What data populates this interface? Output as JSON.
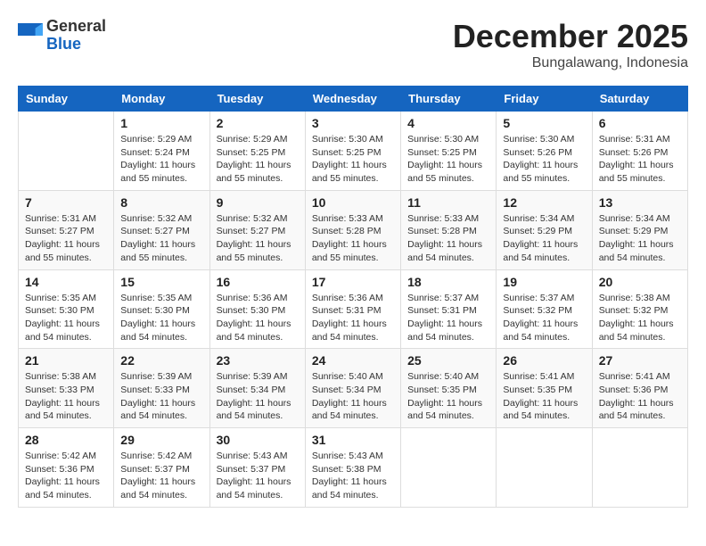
{
  "logo": {
    "general": "General",
    "blue": "Blue"
  },
  "header": {
    "month": "December 2025",
    "location": "Bungalawang, Indonesia"
  },
  "weekdays": [
    "Sunday",
    "Monday",
    "Tuesday",
    "Wednesday",
    "Thursday",
    "Friday",
    "Saturday"
  ],
  "weeks": [
    [
      {
        "day": "",
        "info": ""
      },
      {
        "day": "1",
        "info": "Sunrise: 5:29 AM\nSunset: 5:24 PM\nDaylight: 11 hours\nand 55 minutes."
      },
      {
        "day": "2",
        "info": "Sunrise: 5:29 AM\nSunset: 5:25 PM\nDaylight: 11 hours\nand 55 minutes."
      },
      {
        "day": "3",
        "info": "Sunrise: 5:30 AM\nSunset: 5:25 PM\nDaylight: 11 hours\nand 55 minutes."
      },
      {
        "day": "4",
        "info": "Sunrise: 5:30 AM\nSunset: 5:25 PM\nDaylight: 11 hours\nand 55 minutes."
      },
      {
        "day": "5",
        "info": "Sunrise: 5:30 AM\nSunset: 5:26 PM\nDaylight: 11 hours\nand 55 minutes."
      },
      {
        "day": "6",
        "info": "Sunrise: 5:31 AM\nSunset: 5:26 PM\nDaylight: 11 hours\nand 55 minutes."
      }
    ],
    [
      {
        "day": "7",
        "info": "Sunrise: 5:31 AM\nSunset: 5:27 PM\nDaylight: 11 hours\nand 55 minutes."
      },
      {
        "day": "8",
        "info": "Sunrise: 5:32 AM\nSunset: 5:27 PM\nDaylight: 11 hours\nand 55 minutes."
      },
      {
        "day": "9",
        "info": "Sunrise: 5:32 AM\nSunset: 5:27 PM\nDaylight: 11 hours\nand 55 minutes."
      },
      {
        "day": "10",
        "info": "Sunrise: 5:33 AM\nSunset: 5:28 PM\nDaylight: 11 hours\nand 55 minutes."
      },
      {
        "day": "11",
        "info": "Sunrise: 5:33 AM\nSunset: 5:28 PM\nDaylight: 11 hours\nand 54 minutes."
      },
      {
        "day": "12",
        "info": "Sunrise: 5:34 AM\nSunset: 5:29 PM\nDaylight: 11 hours\nand 54 minutes."
      },
      {
        "day": "13",
        "info": "Sunrise: 5:34 AM\nSunset: 5:29 PM\nDaylight: 11 hours\nand 54 minutes."
      }
    ],
    [
      {
        "day": "14",
        "info": "Sunrise: 5:35 AM\nSunset: 5:30 PM\nDaylight: 11 hours\nand 54 minutes."
      },
      {
        "day": "15",
        "info": "Sunrise: 5:35 AM\nSunset: 5:30 PM\nDaylight: 11 hours\nand 54 minutes."
      },
      {
        "day": "16",
        "info": "Sunrise: 5:36 AM\nSunset: 5:30 PM\nDaylight: 11 hours\nand 54 minutes."
      },
      {
        "day": "17",
        "info": "Sunrise: 5:36 AM\nSunset: 5:31 PM\nDaylight: 11 hours\nand 54 minutes."
      },
      {
        "day": "18",
        "info": "Sunrise: 5:37 AM\nSunset: 5:31 PM\nDaylight: 11 hours\nand 54 minutes."
      },
      {
        "day": "19",
        "info": "Sunrise: 5:37 AM\nSunset: 5:32 PM\nDaylight: 11 hours\nand 54 minutes."
      },
      {
        "day": "20",
        "info": "Sunrise: 5:38 AM\nSunset: 5:32 PM\nDaylight: 11 hours\nand 54 minutes."
      }
    ],
    [
      {
        "day": "21",
        "info": "Sunrise: 5:38 AM\nSunset: 5:33 PM\nDaylight: 11 hours\nand 54 minutes."
      },
      {
        "day": "22",
        "info": "Sunrise: 5:39 AM\nSunset: 5:33 PM\nDaylight: 11 hours\nand 54 minutes."
      },
      {
        "day": "23",
        "info": "Sunrise: 5:39 AM\nSunset: 5:34 PM\nDaylight: 11 hours\nand 54 minutes."
      },
      {
        "day": "24",
        "info": "Sunrise: 5:40 AM\nSunset: 5:34 PM\nDaylight: 11 hours\nand 54 minutes."
      },
      {
        "day": "25",
        "info": "Sunrise: 5:40 AM\nSunset: 5:35 PM\nDaylight: 11 hours\nand 54 minutes."
      },
      {
        "day": "26",
        "info": "Sunrise: 5:41 AM\nSunset: 5:35 PM\nDaylight: 11 hours\nand 54 minutes."
      },
      {
        "day": "27",
        "info": "Sunrise: 5:41 AM\nSunset: 5:36 PM\nDaylight: 11 hours\nand 54 minutes."
      }
    ],
    [
      {
        "day": "28",
        "info": "Sunrise: 5:42 AM\nSunset: 5:36 PM\nDaylight: 11 hours\nand 54 minutes."
      },
      {
        "day": "29",
        "info": "Sunrise: 5:42 AM\nSunset: 5:37 PM\nDaylight: 11 hours\nand 54 minutes."
      },
      {
        "day": "30",
        "info": "Sunrise: 5:43 AM\nSunset: 5:37 PM\nDaylight: 11 hours\nand 54 minutes."
      },
      {
        "day": "31",
        "info": "Sunrise: 5:43 AM\nSunset: 5:38 PM\nDaylight: 11 hours\nand 54 minutes."
      },
      {
        "day": "",
        "info": ""
      },
      {
        "day": "",
        "info": ""
      },
      {
        "day": "",
        "info": ""
      }
    ]
  ]
}
